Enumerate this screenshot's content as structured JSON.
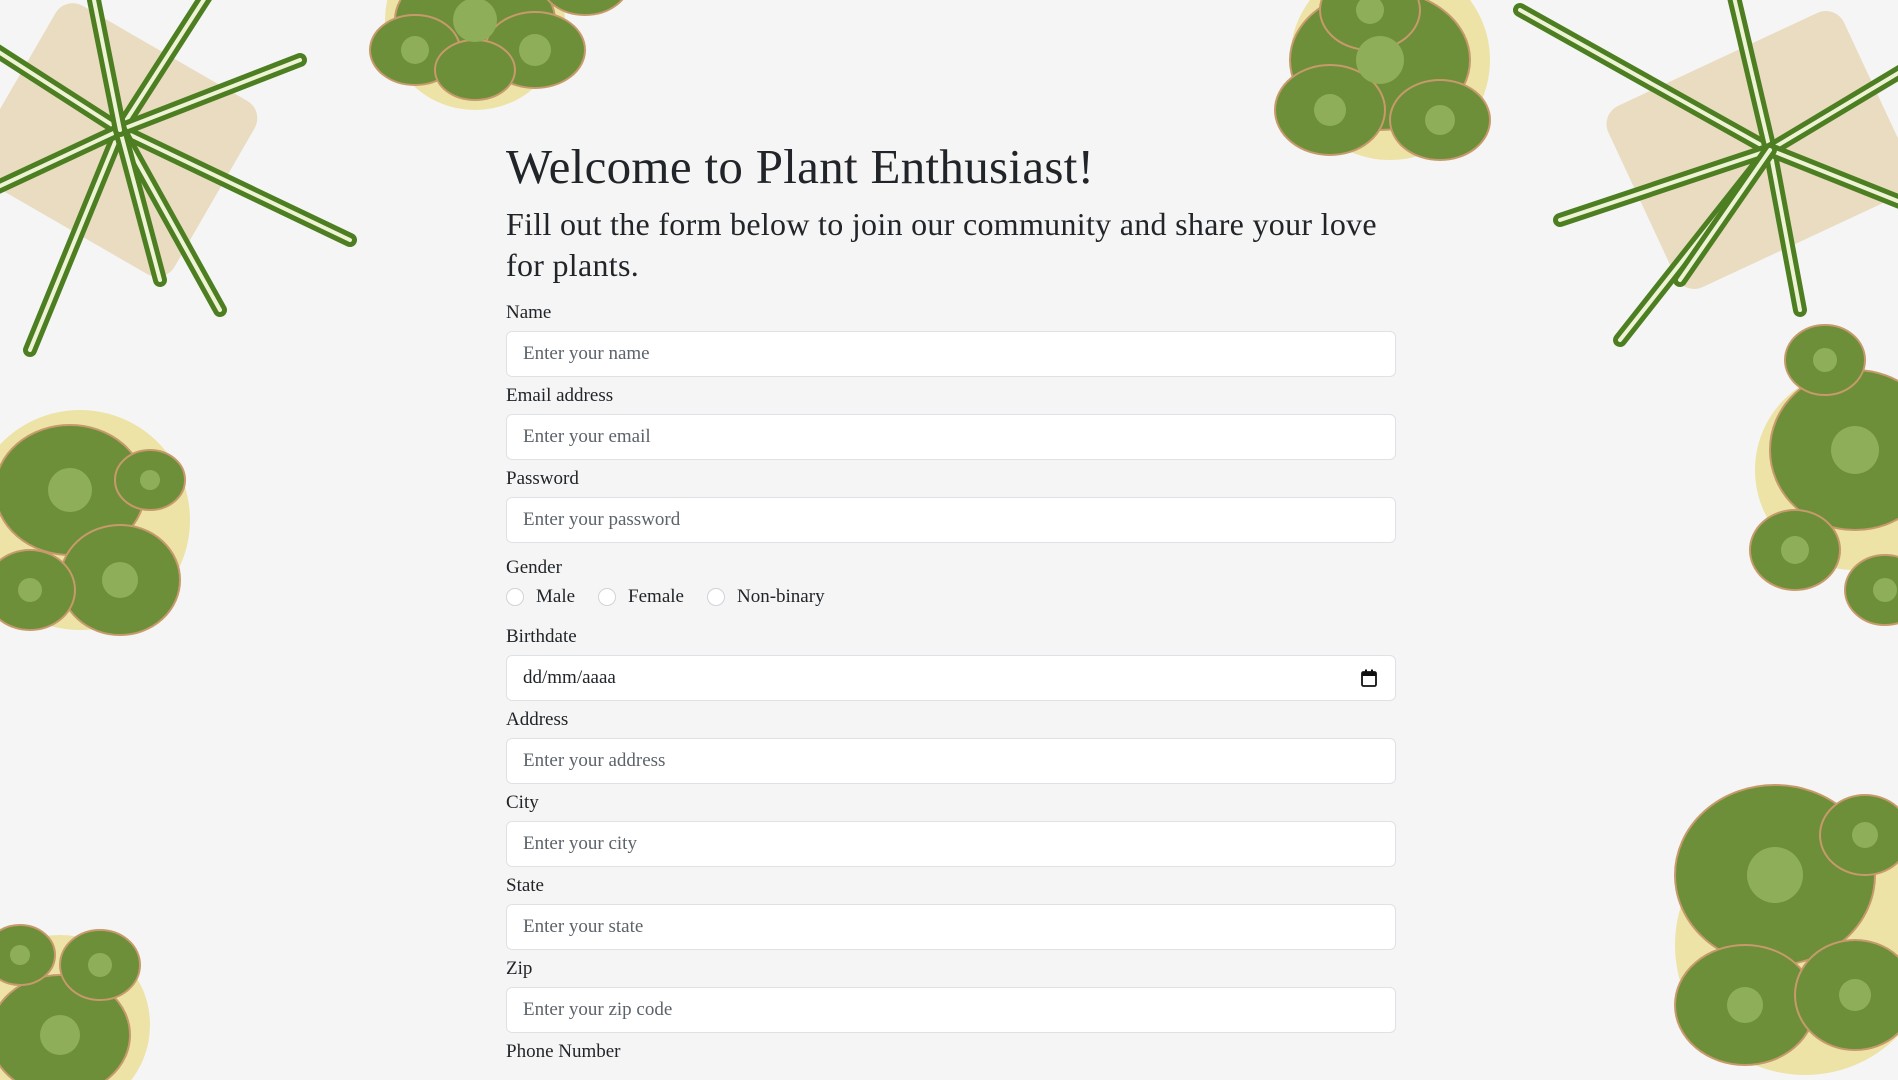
{
  "header": {
    "title": "Welcome to Plant Enthusiast!",
    "subtitle": "Fill out the form below to join our community and share your love for plants."
  },
  "form": {
    "name": {
      "label": "Name",
      "placeholder": "Enter your name"
    },
    "email": {
      "label": "Email address",
      "placeholder": "Enter your email"
    },
    "password": {
      "label": "Password",
      "placeholder": "Enter your password"
    },
    "gender": {
      "label": "Gender",
      "options": [
        "Male",
        "Female",
        "Non-binary"
      ]
    },
    "birthdate": {
      "label": "Birthdate",
      "value": "dd/mm/aaaa"
    },
    "address": {
      "label": "Address",
      "placeholder": "Enter your address"
    },
    "city": {
      "label": "City",
      "placeholder": "Enter your city"
    },
    "state": {
      "label": "State",
      "placeholder": "Enter your state"
    },
    "zip": {
      "label": "Zip",
      "placeholder": "Enter your zip code"
    },
    "phone": {
      "label": "Phone Number"
    }
  },
  "decor": {
    "spider_plant_icon": "spider-plant-icon",
    "succulent_icon": "succulent-icon",
    "calendar_icon": "calendar-icon"
  },
  "colors": {
    "background": "#f5f5f5",
    "input_border": "#dee2e6",
    "text": "#212529",
    "placeholder": "#5c636a",
    "leaf_dark": "#3f6b1f",
    "leaf_light": "#e6eec9",
    "succulent": "#6d8f3a",
    "pot": "#e9dcc0"
  }
}
